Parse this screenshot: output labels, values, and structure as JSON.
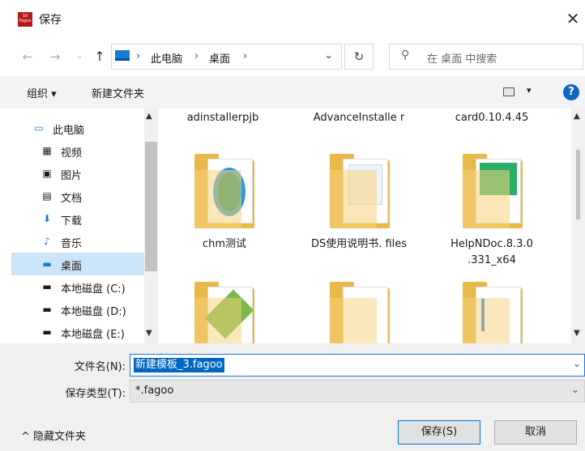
{
  "window": {
    "title": "保存",
    "app_icon_text": "10 Fagoo",
    "close_glyph": "✕"
  },
  "nav": {
    "back": "←",
    "forward": "→",
    "recent": "⌄",
    "up": "↑",
    "breadcrumb": [
      "此电脑",
      "桌面"
    ],
    "separator": "›",
    "dropdown": "⌄",
    "refresh": "↻",
    "search_icon": "⚲",
    "search_placeholder": "在 桌面 中搜索"
  },
  "toolbar": {
    "organize_label": "组织 ▾",
    "new_folder_label": "新建文件夹",
    "view_drop": "▾",
    "help": "?"
  },
  "sidebar": {
    "items": [
      {
        "label": "此电脑",
        "icon": "computer-icon",
        "glyph": "▭"
      },
      {
        "label": "视频",
        "icon": "video-icon",
        "glyph": "▦"
      },
      {
        "label": "图片",
        "icon": "image-icon",
        "glyph": "▣"
      },
      {
        "label": "文档",
        "icon": "document-icon",
        "glyph": "▤"
      },
      {
        "label": "下载",
        "icon": "download-icon",
        "glyph": "⬇"
      },
      {
        "label": "音乐",
        "icon": "music-icon",
        "glyph": "♪"
      },
      {
        "label": "桌面",
        "icon": "desktop-icon",
        "glyph": "▬"
      },
      {
        "label": "本地磁盘 (C:)",
        "icon": "drive-c-icon",
        "glyph": "▬"
      },
      {
        "label": "本地磁盘 (D:)",
        "icon": "drive-d-icon",
        "glyph": "▬"
      },
      {
        "label": "本地磁盘 (E:)",
        "icon": "drive-e-icon",
        "glyph": "▬"
      }
    ],
    "selected": "桌面",
    "scroll_up": "▲",
    "scroll_down": "▼"
  },
  "files": {
    "row0": [
      "adinstallerpjb",
      "AdvanceInstalle r",
      "card0.10.4.45"
    ],
    "row1": [
      "chm测试",
      "DS使用说明书. files",
      "HelpNDoc.8.3.0 .331_x64"
    ],
    "scroll_up": "▲",
    "scroll_down": "▼"
  },
  "form": {
    "filename_label": "文件名(N):",
    "filename_value": "新建模板_3.fagoo",
    "filetype_label": "保存类型(T):",
    "filetype_value": "*.fagoo",
    "dropdown": "⌄"
  },
  "footer": {
    "hide_folders_label": "^ 隐藏文件夹",
    "save_label": "保存(S)",
    "cancel_label": "取消"
  },
  "colors": {
    "accent": "#0067c0",
    "folder": "#e8b84a",
    "selected": "#cce4f7"
  }
}
